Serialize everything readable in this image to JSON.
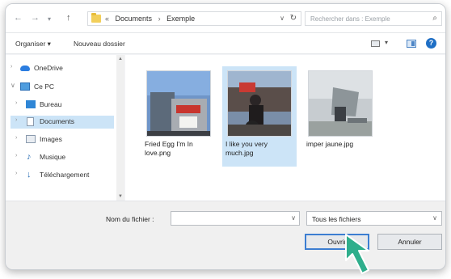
{
  "window": {
    "nav": {
      "back_icon": "arrow-left-icon",
      "forward_icon": "arrow-right-icon",
      "recent_icon": "chevron-down-icon",
      "up_icon": "arrow-up-icon"
    },
    "breadcrumb": {
      "overflow": "«",
      "items": [
        "Documents",
        "Exemple"
      ],
      "separator": "›"
    },
    "search": {
      "placeholder": "Rechercher dans : Exemple"
    }
  },
  "toolbar": {
    "organize_label": "Organiser ▾",
    "new_folder_label": "Nouveau dossier"
  },
  "sidebar": {
    "items": [
      {
        "label": "OneDrive",
        "icon": "cloud-icon",
        "expanded": false
      },
      {
        "label": "Ce PC",
        "icon": "computer-icon",
        "expanded": true
      },
      {
        "label": "Bureau",
        "icon": "desktop-icon",
        "expanded": false
      },
      {
        "label": "Documents",
        "icon": "documents-icon",
        "expanded": false,
        "selected": true
      },
      {
        "label": "Images",
        "icon": "pictures-icon",
        "expanded": false
      },
      {
        "label": "Musique",
        "icon": "music-icon",
        "expanded": false
      },
      {
        "label": "Téléchargement",
        "icon": "download-icon",
        "expanded": false
      }
    ]
  },
  "files": [
    {
      "name": "Fried Egg I'm In love.png",
      "selected": false
    },
    {
      "name": "I like you very much.jpg",
      "selected": true
    },
    {
      "name": "imper jaune.jpg",
      "selected": false
    }
  ],
  "bottom": {
    "filename_label": "Nom du fichier :",
    "filename_value": "",
    "filter_value": "Tous les fichiers",
    "open_label": "Ouvrir",
    "cancel_label": "Annuler"
  },
  "colors": {
    "accent": "#3c7ed2",
    "selection": "#cce4f7",
    "pointer": "#2fae8c"
  }
}
